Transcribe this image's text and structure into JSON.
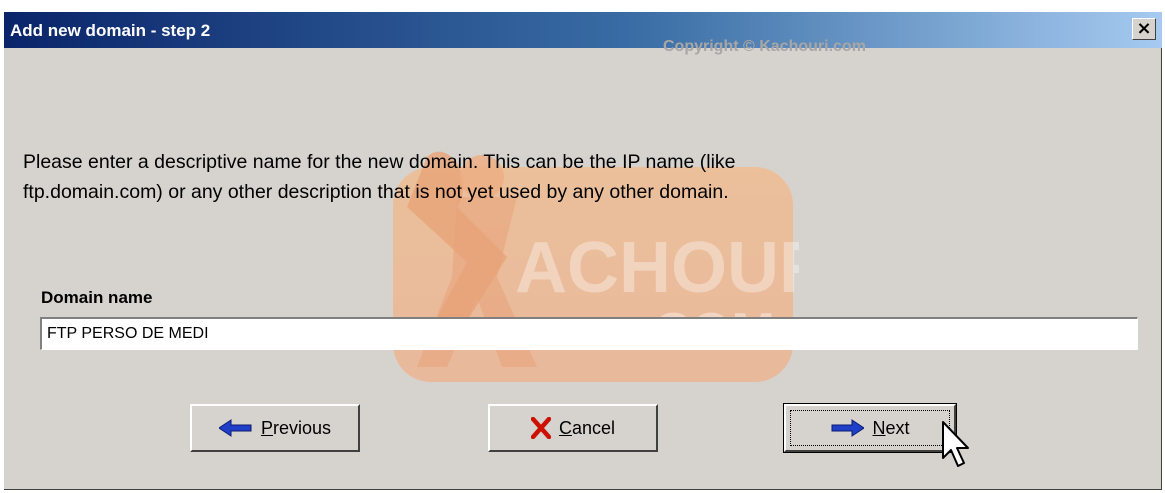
{
  "window": {
    "title": "Add new domain - step 2",
    "close_label": "×"
  },
  "watermark": {
    "copyright": "Copyright © Kachouri.com",
    "logo_main": "ACHOURI",
    "logo_sub": ".COM"
  },
  "instructions": {
    "line1": "Please enter a descriptive name for the new domain. This can be the IP name (like",
    "line2": "ftp.domain.com) or any other description that is not yet used by any other domain."
  },
  "domain_field": {
    "label": "Domain name",
    "value": "FTP PERSO DE MEDI"
  },
  "buttons": {
    "previous": {
      "mnemonic": "P",
      "rest": "revious",
      "icon": "arrow-left-icon"
    },
    "cancel": {
      "mnemonic": "C",
      "rest": "ancel",
      "icon": "red-x-icon"
    },
    "next": {
      "mnemonic": "N",
      "rest": "ext",
      "icon": "arrow-right-icon"
    }
  },
  "colors": {
    "titlebar_start": "#0a246a",
    "titlebar_end": "#a6caf0",
    "dialog_bg": "#d6d3ce",
    "arrow_blue": "#1f3fc8",
    "cancel_red": "#cc1100"
  }
}
